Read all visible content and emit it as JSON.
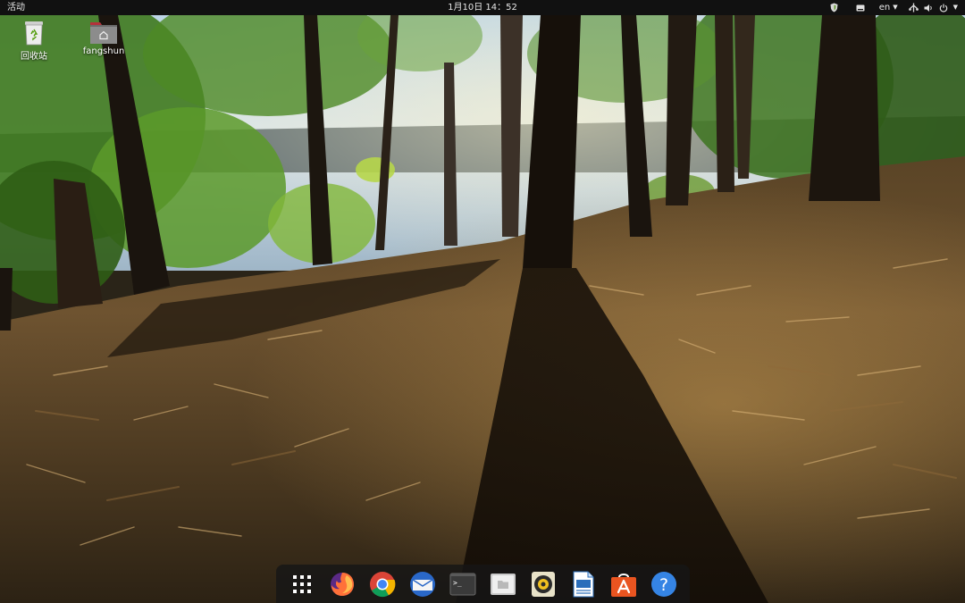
{
  "topbar": {
    "activities_label": "活动",
    "clock": "1月10日  14：52",
    "language": "en",
    "background_color": "#111111"
  },
  "desktop_icons": [
    {
      "label": "回收站",
      "icon": "trash-icon"
    },
    {
      "label": "fangshun",
      "icon": "home-folder-icon"
    }
  ],
  "tray_icons": [
    "shield-icon",
    "keyboard-icon",
    "network-icon",
    "volume-icon",
    "power-icon"
  ],
  "dock": {
    "apps": [
      {
        "name": "show-applications",
        "icon": "grid-icon"
      },
      {
        "name": "firefox",
        "icon": "firefox-icon"
      },
      {
        "name": "chrome",
        "icon": "chrome-icon"
      },
      {
        "name": "mail",
        "icon": "mail-icon"
      },
      {
        "name": "terminal",
        "icon": "terminal-icon"
      },
      {
        "name": "files",
        "icon": "files-icon"
      },
      {
        "name": "music",
        "icon": "rhythmbox-icon"
      },
      {
        "name": "writer",
        "icon": "document-icon"
      },
      {
        "name": "software",
        "icon": "app-store-icon"
      },
      {
        "name": "help",
        "icon": "help-icon"
      }
    ],
    "terminal_prompt": ">_",
    "help_glyph": "?"
  },
  "colors": {
    "accent_orange": "#e95420",
    "help_blue": "#3584e4",
    "trash_green": "#4e9a06"
  }
}
